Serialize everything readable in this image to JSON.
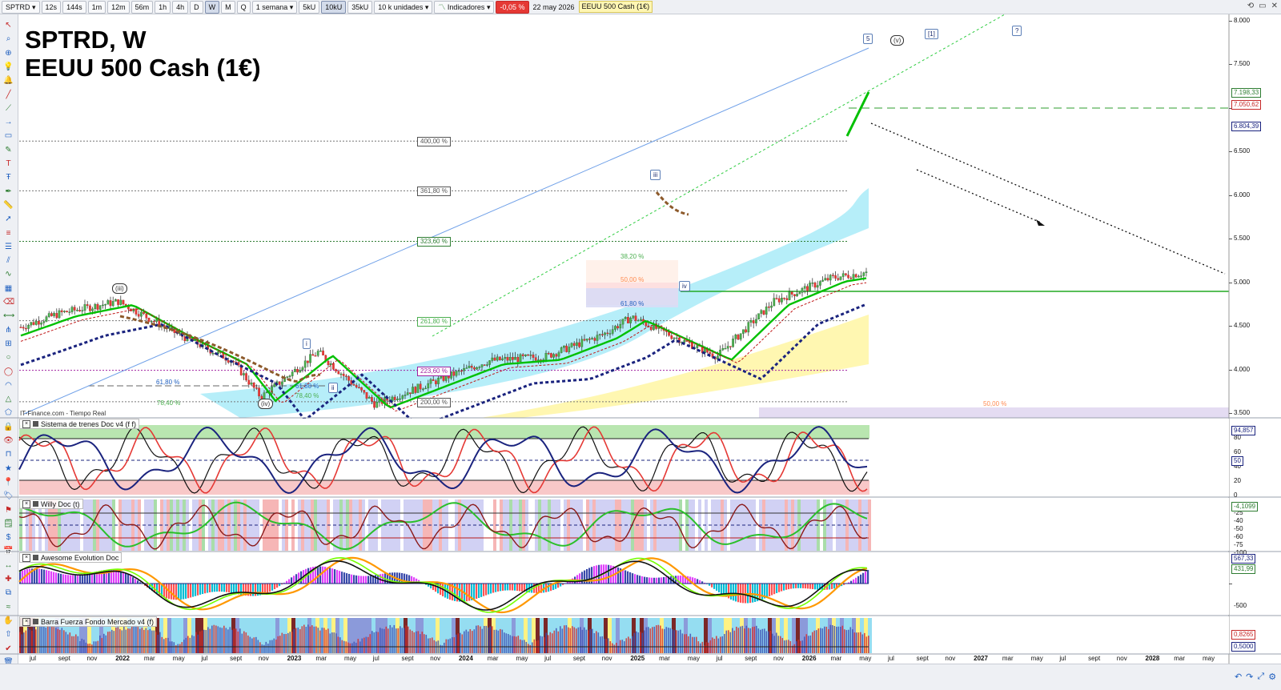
{
  "toolbar": {
    "symbol": "SPTRD",
    "timeframes": [
      "12s",
      "144s",
      "1m",
      "12m",
      "56m",
      "1h",
      "4h",
      "D",
      "W",
      "M",
      "Q"
    ],
    "selected_timeframe": "W",
    "period": "1 semana",
    "units": [
      "5kU",
      "10kU",
      "35kU"
    ],
    "selected_unit": "10kU",
    "units_select": "10 k unidades",
    "indicators": "Indicadores",
    "change_pct": "-0,05 %",
    "date": "22 may 2026",
    "instrument": "EEUU 500 Cash (1€)"
  },
  "legend": [
    "Precio",
    "Cierre (W)",
    "Tunel Domenec v4 (t t t t t)",
    "Control Total Doc v.6"
  ],
  "chart_title": {
    "line1": "SPTRD, W",
    "line2": "EEUU 500 Cash (1€)"
  },
  "attribution": "IT-Finance.com - Tiempo Real",
  "panels": {
    "trenes": "Sistema de trenes Doc v4 (f f)",
    "willy": "Willy Doc (t)",
    "awesome": "Awesome Evolution Doc",
    "barra": "Barra Fuerza Fondo Mercado v4 (f)"
  },
  "colors": {
    "up_candle": "#2e7d32",
    "down_candle": "#c62828",
    "green_ma": "#00c000",
    "red_ma": "#c01818",
    "navy_ma": "#1a237e",
    "cyan_band": "#8fe4f5",
    "yellow_band": "#fff59d",
    "accent_blue": "#1f5fbf"
  },
  "price_axis": {
    "ticks": [
      "8.000",
      "7.500",
      "7.000",
      "6.500",
      "6.000",
      "5.500",
      "5.000",
      "4.500",
      "4.000",
      "3.500"
    ],
    "current": [
      {
        "label": "7.198,33",
        "color": "#2e7d32"
      },
      {
        "label": "7.050,62",
        "color": "#c62828"
      },
      {
        "label": "6.804,39",
        "color": "#1a237e"
      }
    ]
  },
  "trenes_axis": {
    "ticks": [
      "80",
      "60",
      "40",
      "20",
      "0"
    ],
    "badges": [
      "94,857",
      "50"
    ]
  },
  "willy_axis": {
    "ticks": [
      "-25",
      "-40",
      "-50",
      "-60",
      "-75",
      "-100"
    ],
    "badge": "-4,1099"
  },
  "awesome_axis": {
    "ticks": [
      "-500"
    ],
    "badges": [
      "567,33",
      "431,99"
    ]
  },
  "barra_axis": {
    "badges": [
      "0,8265",
      "0,5000"
    ]
  },
  "fib_levels": [
    {
      "label": "400,00 %",
      "price": 6620
    },
    {
      "label": "361,80 %",
      "price": 6050
    },
    {
      "label": "323,60 %",
      "price": 5470
    },
    {
      "label": "261,80 %",
      "price": 4560
    },
    {
      "label": "223,60 %",
      "price": 3990
    },
    {
      "label": "200,00 %",
      "price": 3630
    }
  ],
  "retracements": [
    {
      "label": "38,20 %"
    },
    {
      "label": "50,00 %"
    },
    {
      "label": "61,80 %"
    }
  ],
  "small_fibs": [
    "61,80 %",
    "78,40 %",
    "61,80 %",
    "78,40 %",
    "50,00 %"
  ],
  "wave_labels": [
    "(iii)",
    "(iv)",
    "i",
    "ii",
    "iii",
    "iv",
    "5",
    "(v)",
    "[1]",
    "?"
  ],
  "x_axis": [
    "jul",
    "sept",
    "nov",
    "2022",
    "mar",
    "may",
    "jul",
    "sept",
    "nov",
    "2023",
    "mar",
    "may",
    "jul",
    "sept",
    "nov",
    "2024",
    "mar",
    "may",
    "jul",
    "sept",
    "nov",
    "2025",
    "mar",
    "may",
    "jul",
    "sept",
    "nov",
    "2026",
    "mar",
    "may",
    "jul",
    "sept",
    "nov",
    "2027",
    "mar",
    "may",
    "jul",
    "sept",
    "nov",
    "2028",
    "mar",
    "may"
  ],
  "chart_data": {
    "type": "candlestick",
    "interval": "W",
    "y_range": [
      3500,
      8000
    ],
    "x_range": [
      "2021-06",
      "2028-06"
    ],
    "series": [
      {
        "name": "Cierre (W)",
        "x": [
          "2021-07",
          "2021-09",
          "2021-11",
          "2022-01",
          "2022-03",
          "2022-05",
          "2022-06",
          "2022-08",
          "2022-10",
          "2022-12",
          "2023-02",
          "2023-04",
          "2023-06",
          "2023-07",
          "2023-10",
          "2023-12",
          "2024-02",
          "2024-04",
          "2024-06",
          "2024-08",
          "2024-10",
          "2024-12",
          "2025-02",
          "2025-04",
          "2025-05",
          "2025-07",
          "2025-09",
          "2025-11",
          "2026-01",
          "2026-03",
          "2026-04",
          "2026-05"
        ],
        "values": [
          4200,
          4420,
          4650,
          4780,
          4420,
          4100,
          3680,
          4200,
          3600,
          3850,
          4100,
          4150,
          4400,
          4600,
          4150,
          4780,
          5050,
          5150,
          5500,
          5400,
          5800,
          6050,
          6000,
          5050,
          5750,
          6200,
          6600,
          6800,
          6900,
          6500,
          7050,
          7420
        ]
      }
    ]
  }
}
